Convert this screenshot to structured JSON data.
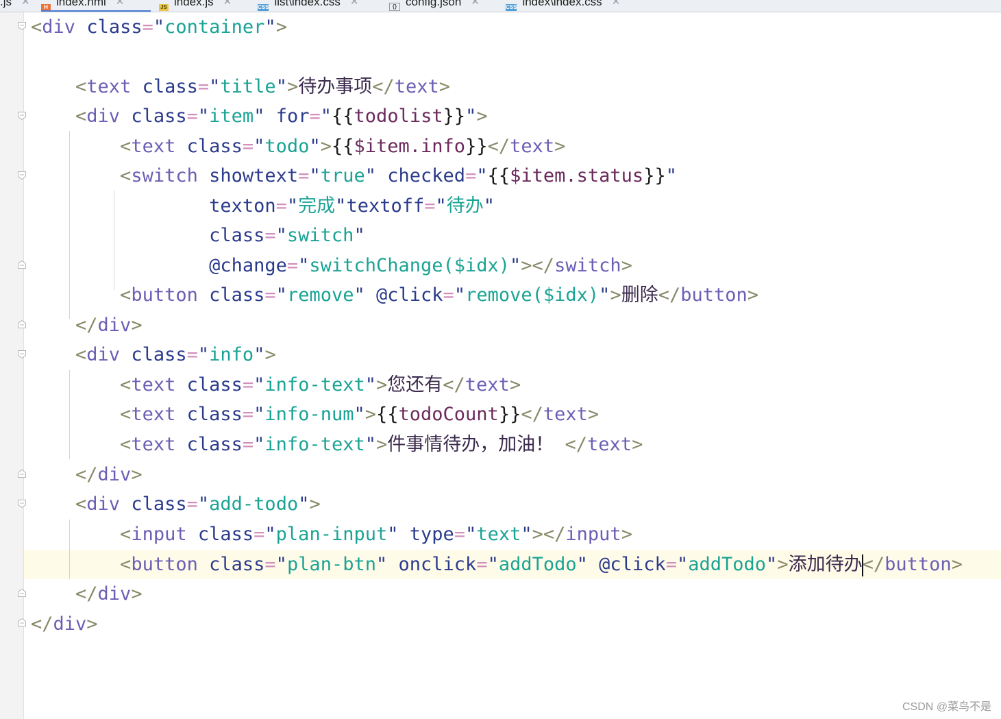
{
  "tabs": [
    {
      "label": ".js",
      "icon": "",
      "active": false
    },
    {
      "label": "index.hml",
      "icon": "H",
      "active": true
    },
    {
      "label": "index.js",
      "icon": "JS",
      "active": false
    },
    {
      "label": "list\\index.css",
      "icon": "CSS",
      "active": false
    },
    {
      "label": "config.json",
      "icon": "{}",
      "active": false
    },
    {
      "label": "index\\index.css",
      "icon": "CSS",
      "active": false
    }
  ],
  "code": {
    "tag_div": "div",
    "tag_text": "text",
    "tag_switch": "switch",
    "tag_button": "button",
    "tag_input": "input",
    "attr_class": "class",
    "attr_for": "for",
    "attr_showtext": "showtext",
    "attr_checked": "checked",
    "attr_texton": "texton",
    "attr_textoff": "textoff",
    "attr_change": "@change",
    "attr_click": "@click",
    "attr_type": "type",
    "attr_onclick": "onclick",
    "val_container": "container",
    "val_title": "title",
    "val_item": "item",
    "val_todolist": "todolist",
    "val_todo": "todo",
    "val_item_info": "$item.info",
    "val_true": "true",
    "val_item_status": "$item.status",
    "val_done": "完成",
    "val_pending": "待办",
    "val_switch": "switch",
    "val_switch_change": "switchChange($idx)",
    "val_remove": "remove",
    "val_remove_call": "remove($idx)",
    "val_info": "info",
    "val_info_text": "info-text",
    "val_info_num": "info-num",
    "val_todo_count": "todoCount",
    "val_add_todo": "add-todo",
    "val_plan_input": "plan-input",
    "val_text": "text",
    "val_plan_btn": "plan-btn",
    "val_add_todo_fn": "addTodo",
    "txt_title": "待办事项",
    "txt_delete": "删除",
    "txt_you_still_have": "您还有",
    "txt_tasks_pending": "件事情待办，加油！",
    "txt_add_todo": "添加待办"
  },
  "watermark": "CSDN @菜鸟不是"
}
